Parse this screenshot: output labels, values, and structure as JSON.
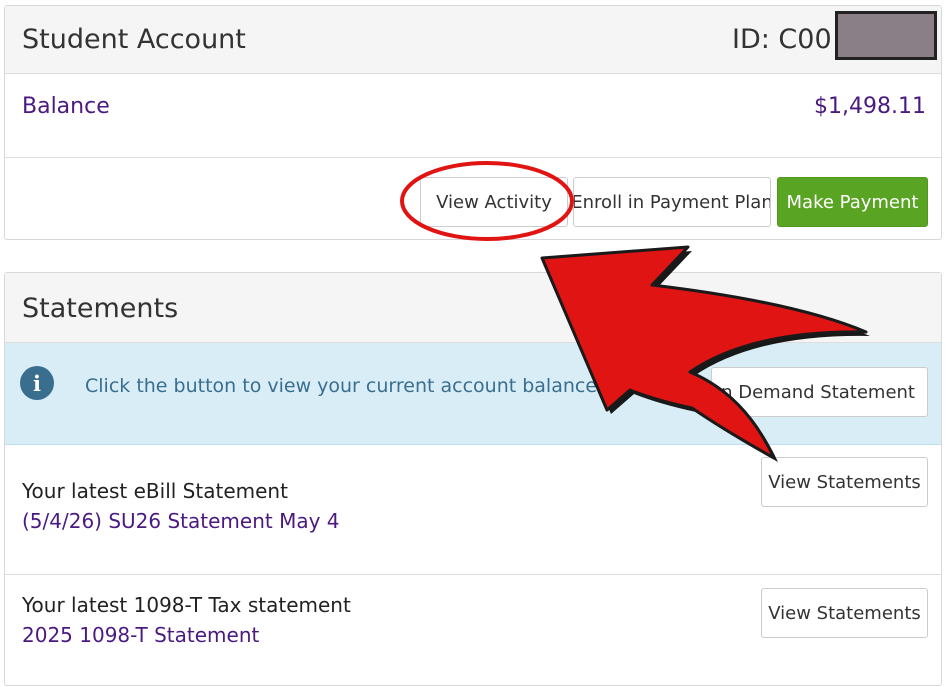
{
  "account": {
    "title": "Student Account",
    "id_label": "ID: C00",
    "balance_label": "Balance",
    "balance_value": "$1,498.11",
    "buttons": {
      "view_activity": "View Activity",
      "enroll_payment_plan": "Enroll in Payment Plan",
      "make_payment": "Make Payment"
    }
  },
  "statements": {
    "title": "Statements",
    "info_icon": "i",
    "info_text": "Click the button to view your current account balance and details.",
    "on_demand_button": "On Demand Statement",
    "ebill": {
      "title": "Your latest eBill Statement",
      "link": "(5/4/26) SU26 Statement May 4",
      "button": "View Statements"
    },
    "tax": {
      "title": "Your latest 1098-T Tax statement",
      "link": "2025 1098-T Statement",
      "button": "View Statements"
    }
  },
  "colors": {
    "accent_purple": "#4b1a80",
    "primary_green": "#5aa424",
    "info_blue": "#d9edf7",
    "annotation_red": "#e11414"
  },
  "icons": {
    "info": "info-circle-icon"
  }
}
